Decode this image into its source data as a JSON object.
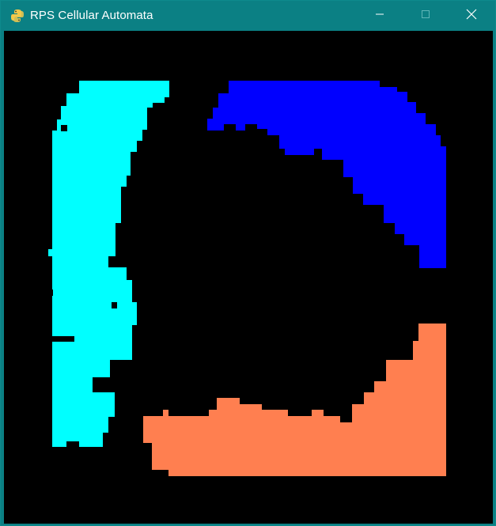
{
  "window": {
    "title": "RPS Cellular Automata",
    "app_icon": "python-icon",
    "controls": {
      "minimize_icon": "minimize-icon",
      "maximize_icon": "maximize-icon",
      "close_icon": "close-icon"
    }
  },
  "colors": {
    "titlebar": "#0b8084",
    "canvas_background": "#000000",
    "cyan_region": "#00ffff",
    "blue_region": "#0000ff",
    "orange_region": "#ff7f50"
  },
  "canvas": {
    "regions": [
      {
        "name": "cyan-region",
        "color": "#00ffff"
      },
      {
        "name": "blue-region",
        "color": "#0000ff"
      },
      {
        "name": "orange-region",
        "color": "#ff7f50"
      }
    ]
  }
}
